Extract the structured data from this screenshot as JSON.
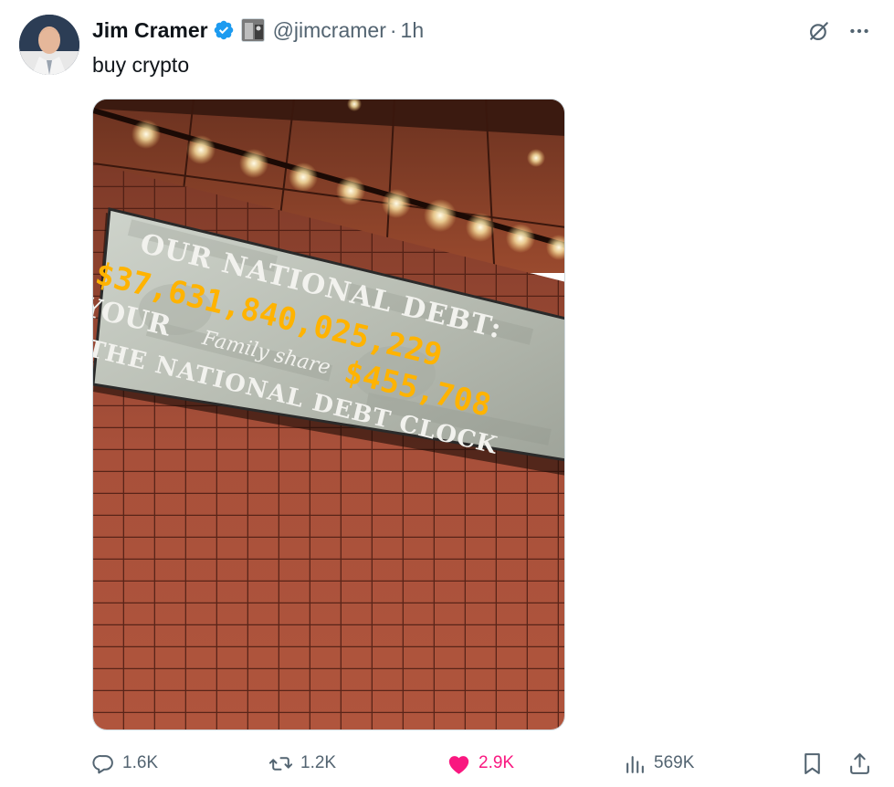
{
  "author": {
    "name": "Jim Cramer",
    "handle": "@jimcramer",
    "separator": "·",
    "time": "1h",
    "verified_color": "#1d9bf0"
  },
  "tweet": {
    "text": "buy crypto"
  },
  "media": {
    "board": {
      "line1": "OUR NATIONAL DEBT:",
      "debt_value": "$37,631,840,025,229",
      "line2": "YOUR",
      "family_share_label": "Family share",
      "family_share_value": "$455,708",
      "line3": "THE NATIONAL DEBT CLOCK"
    }
  },
  "actions": {
    "replies": "1.6K",
    "reposts": "1.2K",
    "likes": "2.9K",
    "views": "569K",
    "like_color": "#f91880",
    "icon_color": "#536471"
  },
  "icons": [
    "grok-icon",
    "more-icon",
    "reply-icon",
    "repost-icon",
    "like-icon",
    "views-icon",
    "bookmark-icon",
    "share-icon",
    "verified-badge-icon"
  ]
}
